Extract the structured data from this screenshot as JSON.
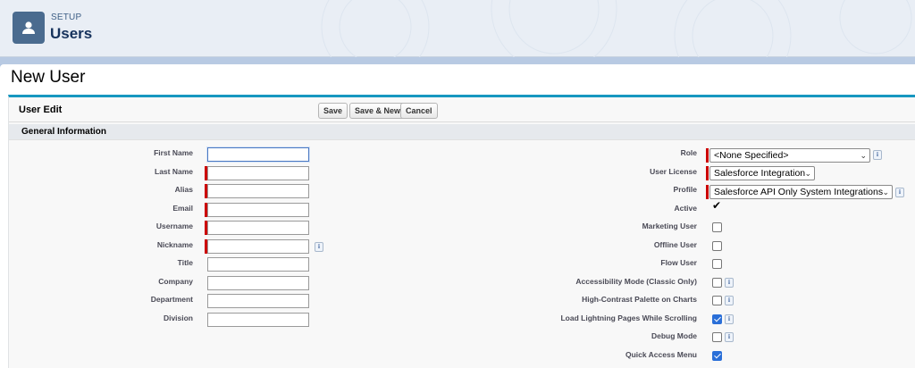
{
  "header": {
    "eyebrow": "SETUP",
    "title": "Users",
    "icon": "user-icon"
  },
  "page": {
    "title": "New User"
  },
  "edit": {
    "title": "User Edit",
    "buttons": {
      "save": "Save",
      "save_new": "Save & New",
      "cancel": "Cancel"
    },
    "section_title": "General Information"
  },
  "left_fields": [
    {
      "label": "First Name",
      "value": "",
      "required": false,
      "focused": true
    },
    {
      "label": "Last Name",
      "value": "",
      "required": true
    },
    {
      "label": "Alias",
      "value": "",
      "required": true
    },
    {
      "label": "Email",
      "value": "",
      "required": true
    },
    {
      "label": "Username",
      "value": "",
      "required": true
    },
    {
      "label": "Nickname",
      "value": "",
      "required": true,
      "info": true
    },
    {
      "label": "Title",
      "value": ""
    },
    {
      "label": "Company",
      "value": ""
    },
    {
      "label": "Department",
      "value": ""
    },
    {
      "label": "Division",
      "value": ""
    }
  ],
  "right_fields": {
    "role": {
      "label": "Role",
      "value": "<None Specified>"
    },
    "user_license": {
      "label": "User License",
      "value": "Salesforce Integration"
    },
    "profile": {
      "label": "Profile",
      "value": "Salesforce API Only System Integrations"
    },
    "active": {
      "label": "Active",
      "checked": true
    },
    "marketing_user": {
      "label": "Marketing User",
      "checked": false
    },
    "offline_user": {
      "label": "Offline User",
      "checked": false
    },
    "flow_user": {
      "label": "Flow User",
      "checked": false
    },
    "accessibility_mode": {
      "label": "Accessibility Mode (Classic Only)",
      "checked": false
    },
    "high_contrast": {
      "label": "High-Contrast Palette on Charts",
      "checked": false
    },
    "load_lightning": {
      "label": "Load Lightning Pages While Scrolling",
      "checked": true
    },
    "debug_mode": {
      "label": "Debug Mode",
      "checked": false
    },
    "quick_access": {
      "label": "Quick Access Menu",
      "checked": true
    }
  },
  "info_glyph": "i",
  "colors": {
    "required": "#cc0000",
    "section_accent": "#1797c0",
    "checkbox_checked": "#2a6fd8",
    "header_icon_bg": "#4a6b8f"
  }
}
